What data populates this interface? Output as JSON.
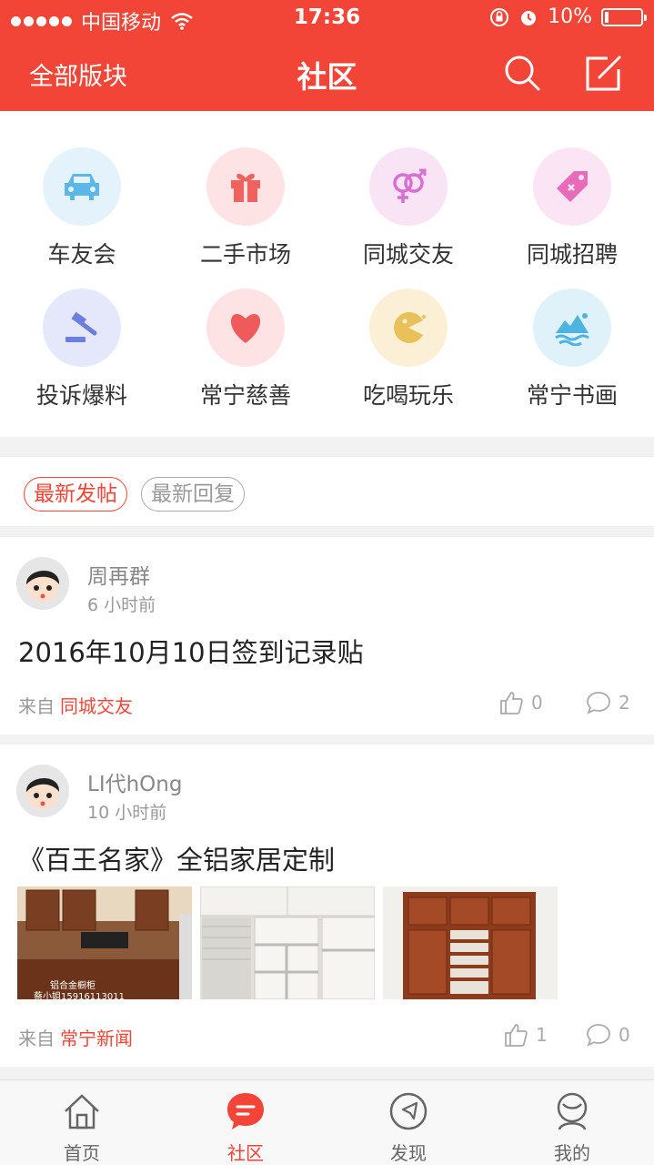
{
  "status": {
    "carrier": "中国移动",
    "time": "17:36",
    "battery": "10%",
    "battery_level": 0.1
  },
  "nav": {
    "left": "全部版块",
    "title": "社区"
  },
  "categories": [
    {
      "label": "车友会",
      "icon": "car-icon",
      "bg": "#e3f2fb",
      "color": "#5bb7e8"
    },
    {
      "label": "二手市场",
      "icon": "gift-icon",
      "bg": "#fde3e3",
      "color": "#f0625e"
    },
    {
      "label": "同城交友",
      "icon": "gender-icon",
      "bg": "#f9e4f6",
      "color": "#d96fd0"
    },
    {
      "label": "同城招聘",
      "icon": "tag-icon",
      "bg": "#fbe4f4",
      "color": "#e86bb9"
    },
    {
      "label": "投诉爆料",
      "icon": "gavel-icon",
      "bg": "#e4e8fa",
      "color": "#6b7fe0"
    },
    {
      "label": "常宁慈善",
      "icon": "heart-icon",
      "bg": "#fde3e3",
      "color": "#ef5a5a"
    },
    {
      "label": "吃喝玩乐",
      "icon": "pacman-icon",
      "bg": "#fbf0d6",
      "color": "#e9c15a"
    },
    {
      "label": "常宁书画",
      "icon": "mountain-icon",
      "bg": "#dff2fa",
      "color": "#4fb3e0"
    }
  ],
  "tabs": {
    "latest_post": "最新发帖",
    "latest_reply": "最新回复"
  },
  "posts": [
    {
      "author": "周再群",
      "time": "6 小时前",
      "title": "2016年10月10日签到记录贴",
      "from_label": "来自",
      "board": "同城交友",
      "likes": "0",
      "comments": "2"
    },
    {
      "author": "LI代hOng",
      "time": "10 小时前",
      "title": "《百王名家》全铝家居定制",
      "from_label": "来自",
      "board": "常宁新闻",
      "likes": "1",
      "comments": "0",
      "thumb_caption_1": "铝合金橱柜",
      "thumb_caption_2": "蔡小姐15916113011"
    }
  ],
  "tabbar": {
    "home": "首页",
    "community": "社区",
    "discover": "发现",
    "mine": "我的"
  },
  "colors": {
    "accent": "#f24538"
  }
}
